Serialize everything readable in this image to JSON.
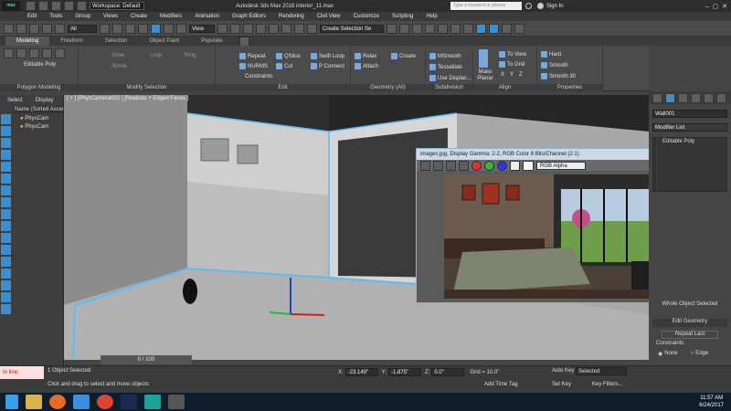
{
  "titlebar": {
    "workspace": "Workspace: Default",
    "title": "Autodesk 3ds Max 2016     interior_11.max",
    "search_placeholder": "Type a keyword or phrase",
    "sign_in": "Sign In"
  },
  "menu": [
    "Edit",
    "Tools",
    "Group",
    "Views",
    "Create",
    "Modifiers",
    "Animation",
    "Graph Editors",
    "Rendering",
    "Civil View",
    "Customize",
    "Scripting",
    "Help"
  ],
  "toolbar": {
    "filter": "All",
    "view": "View",
    "selection_set": "Create Selection Se"
  },
  "ribbon_tabs": [
    "Modeling",
    "Freeform",
    "Selection",
    "Object Paint",
    "Populate"
  ],
  "ribbon": {
    "editable_poly": "Editable Poly",
    "grow": "Grow",
    "shrink": "Shrink",
    "loop": "Loop",
    "ring": "Ring",
    "repeat": "Repeat",
    "qslice": "QSlice",
    "swift_loop": "Swift Loop",
    "nurms": "NURMS",
    "cut": "Cut",
    "p_connect": "P Connect",
    "constraints": "Constraints",
    "relax": "Relax",
    "create": "Create",
    "attach": "Attach",
    "msmooth": "MSmooth",
    "tessellate": "Tessellate",
    "use_displac": "Use Displac...",
    "make_planar": "Make Planar",
    "to_view": "To View",
    "to_grid": "To Grid",
    "x": "X",
    "y": "Y",
    "z": "Z",
    "hard": "Hard",
    "smooth": "Smooth",
    "smooth30": "Smooth 30",
    "groups": [
      "Polygon Modeling",
      "Modify Selection",
      "Edit",
      "Geometry (All)",
      "Subdivision",
      "Align",
      "Properties"
    ]
  },
  "scene_explorer": {
    "tabs": [
      "Select",
      "Display"
    ],
    "header": "Name (Sorted Ascen",
    "items": [
      "PhysCam",
      "PhysCam"
    ]
  },
  "viewport": {
    "label": "[ + ] [PhysCamera002 ] [Realistic + Edged Faces ]"
  },
  "command_panel": {
    "object_name": "Wall001",
    "modifier_list": "Modifier List",
    "stack_item": "Editable Poly",
    "whole_object": "Whole Object Selected",
    "edit_geometry": "Edit Geometry",
    "repeat_last": "Repeat Last",
    "constraints": "Constraints",
    "none": "None",
    "edge": "Edge"
  },
  "render_window": {
    "title": "images.jpg, Display Gamma: 2.2, RGB Color 8 Bits/Channel (2:1)",
    "channel": "RGB Alpha"
  },
  "bottom": {
    "objects_selected": "1 Object Selected",
    "hint": "Click and drag to select and move objects",
    "maxscript": "In line:",
    "frame": "0 / 100",
    "x_label": "X:",
    "x": "-23.149\"",
    "y_label": "Y:",
    "y": "-1.875\"",
    "z_label": "Z:",
    "z": "0.0\"",
    "grid": "Grid = 10.0\"",
    "add_time_tag": "Add Time Tag",
    "auto_key": "Auto Key",
    "selected": "Selected",
    "set_key": "Set Key",
    "key_filters": "Key Filters..."
  },
  "taskbar": {
    "time": "11:57 AM",
    "date": "6/24/2017"
  }
}
